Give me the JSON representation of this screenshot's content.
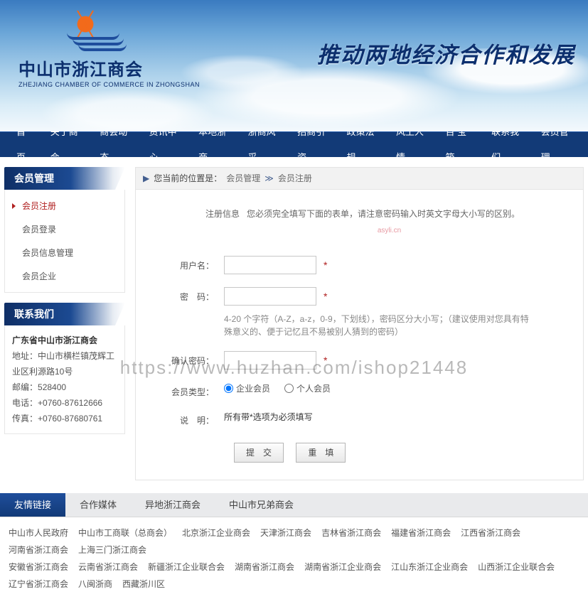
{
  "logo": {
    "title": "中山市浙江商会",
    "subtitle": "ZHEJIANG CHAMBER OF COMMERCE IN ZHONGSHAN"
  },
  "slogan": "推动两地经济合作和发展",
  "navItems": [
    "首页",
    "关于商会",
    "商会动态",
    "资讯中心",
    "本地浙商",
    "浙商风采",
    "招商引资",
    "政策法规",
    "风土人情",
    "百 宝 箱",
    "联系我们",
    "会员管理"
  ],
  "sidebar": {
    "manage": {
      "title": "会员管理",
      "items": [
        "会员注册",
        "会员登录",
        "会员信息管理",
        "会员企业"
      ],
      "activeIndex": 0
    },
    "contact": {
      "title": "联系我们",
      "org": "广东省中山市浙江商会",
      "addrLabel": "地址：",
      "addr": "中山市横栏镇茂辉工业区利源路10号",
      "postLabel": "邮编：",
      "post": "528400",
      "telLabel": "电话：",
      "tel": "+0760-87612666",
      "faxLabel": "传真：",
      "fax": "+0760-87680761"
    }
  },
  "breadcrumb": {
    "prefix": "您当前的位置是：",
    "level1": "会员管理",
    "level2": "会员注册"
  },
  "form": {
    "tipLabel": "注册信息",
    "tipText": "您必须完全填写下面的表单，请注意密码输入时英文字母大小写的区别。",
    "watermark": "asyli.cn",
    "username": {
      "label": "用户名：",
      "value": ""
    },
    "password": {
      "label": "密　码：",
      "value": "",
      "hint": "4-20 个字符（A-Z，a-z，0-9，下划线），密码区分大小写；（建议使用对您具有特殊意义的、便于记忆且不易被别人猜到的密码）"
    },
    "confirm": {
      "label": "确认密码：",
      "value": ""
    },
    "mtype": {
      "label": "会员类型：",
      "options": [
        "企业会员",
        "个人会员"
      ],
      "selectedIndex": 0
    },
    "note": {
      "label": "说　明：",
      "text": "所有带*选项为必须填写"
    },
    "buttons": {
      "submit": "提　交",
      "reset": "重　填"
    }
  },
  "footerTabs": {
    "items": [
      "友情链接",
      "合作媒体",
      "异地浙江商会",
      "中山市兄弟商会"
    ],
    "activeIndex": 0
  },
  "footerLinks": {
    "row1": [
      "中山市人民政府",
      "中山市工商联（总商会）",
      "北京浙江企业商会",
      "天津浙江商会",
      "吉林省浙江商会",
      "福建省浙江商会",
      "江西省浙江商会",
      "河南省浙江商会",
      "上海三门浙江商会"
    ],
    "row2": [
      "安徽省浙江商会",
      "云南省浙江商会",
      "新疆浙江企业联合会",
      "湖南省浙江商会",
      "湖南省浙江企业商会",
      "江山东浙江企业商会",
      "山西浙江企业联合会",
      "辽宁省浙江商会",
      "八闽浙商",
      "西藏浙川区"
    ]
  },
  "watermark": "https://www.huzhan.com/ishop21448"
}
